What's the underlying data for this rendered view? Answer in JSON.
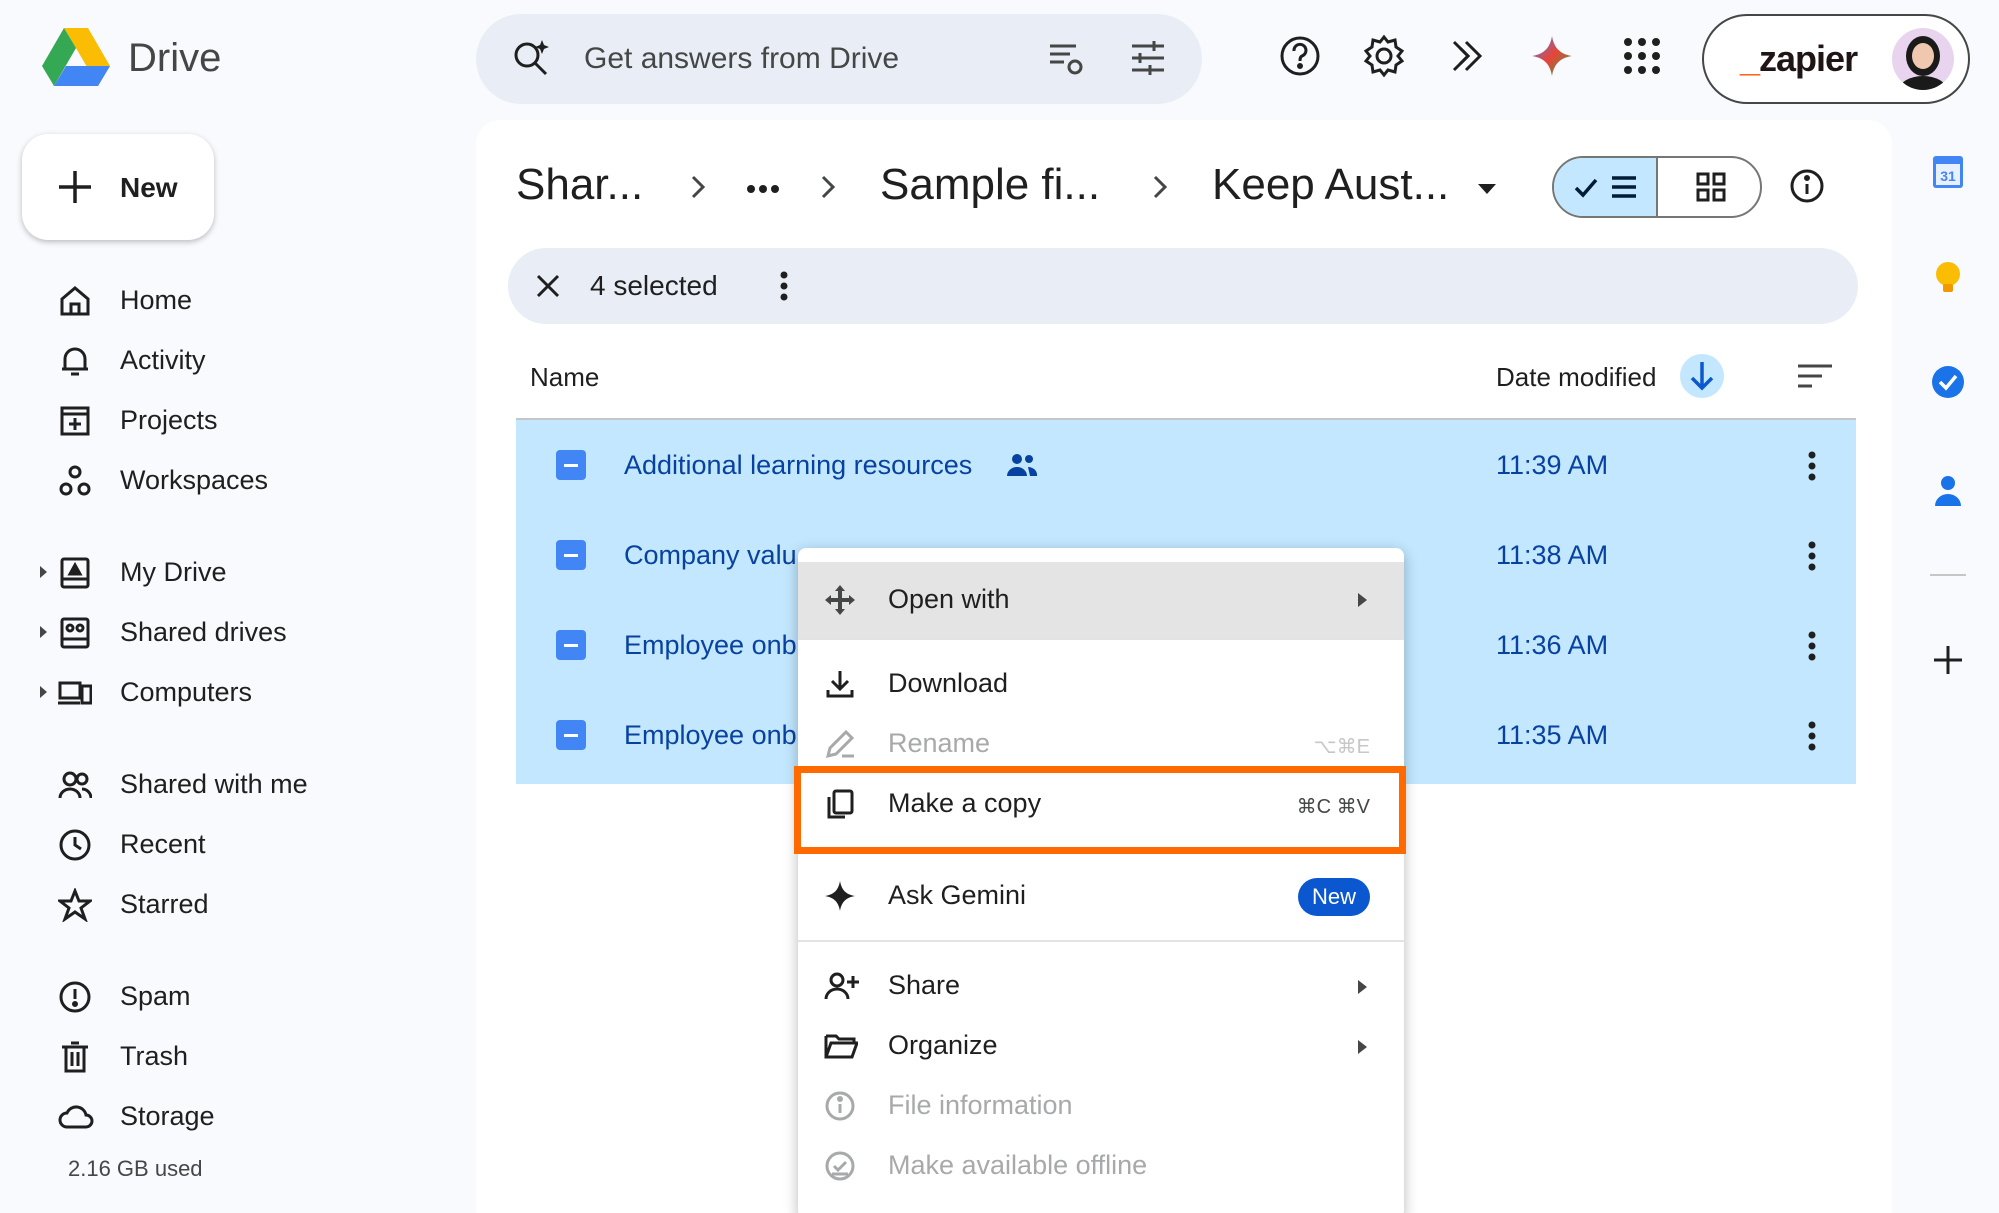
{
  "app": {
    "name": "Drive"
  },
  "search": {
    "placeholder": "Get answers from Drive"
  },
  "account": {
    "brand": "zapier"
  },
  "sidebar": {
    "new_label": "New",
    "items": [
      {
        "label": "Home",
        "icon": "home-icon"
      },
      {
        "label": "Activity",
        "icon": "bell-icon"
      },
      {
        "label": "Projects",
        "icon": "projects-icon"
      },
      {
        "label": "Workspaces",
        "icon": "workspaces-icon"
      },
      {
        "label": "My Drive",
        "icon": "my-drive-icon"
      },
      {
        "label": "Shared drives",
        "icon": "shared-drives-icon"
      },
      {
        "label": "Computers",
        "icon": "computers-icon"
      },
      {
        "label": "Shared with me",
        "icon": "people-icon"
      },
      {
        "label": "Recent",
        "icon": "clock-icon"
      },
      {
        "label": "Starred",
        "icon": "star-icon"
      },
      {
        "label": "Spam",
        "icon": "spam-icon"
      },
      {
        "label": "Trash",
        "icon": "trash-icon"
      },
      {
        "label": "Storage",
        "icon": "cloud-icon"
      }
    ],
    "storage_used": "2.16 GB used"
  },
  "breadcrumb": {
    "items": [
      "Shar...",
      "Sample fi...",
      "Keep Aust..."
    ]
  },
  "selection": {
    "count_label": "4 selected"
  },
  "columns": {
    "name": "Name",
    "date_modified": "Date modified"
  },
  "files": [
    {
      "name": "Additional learning resources",
      "date": "11:39 AM",
      "shared": true
    },
    {
      "name": "Company valu",
      "date": "11:38 AM",
      "shared": false
    },
    {
      "name": "Employee onb",
      "date": "11:36 AM",
      "shared": false
    },
    {
      "name": "Employee onb",
      "date": "11:35 AM",
      "shared": false
    }
  ],
  "context_menu": {
    "open_with": "Open with",
    "download": "Download",
    "rename": "Rename",
    "rename_shortcut": "⌥⌘E",
    "make_copy": "Make a copy",
    "make_copy_shortcut": "⌘C ⌘V",
    "ask_gemini": "Ask Gemini",
    "new_badge": "New",
    "share": "Share",
    "organize": "Organize",
    "file_information": "File information",
    "make_offline": "Make available offline"
  },
  "side_panel": {
    "calendar_day": "31"
  },
  "colors": {
    "selection": "#c2e7ff",
    "highlight": "#ff6a00",
    "accent": "#0b57d0"
  }
}
